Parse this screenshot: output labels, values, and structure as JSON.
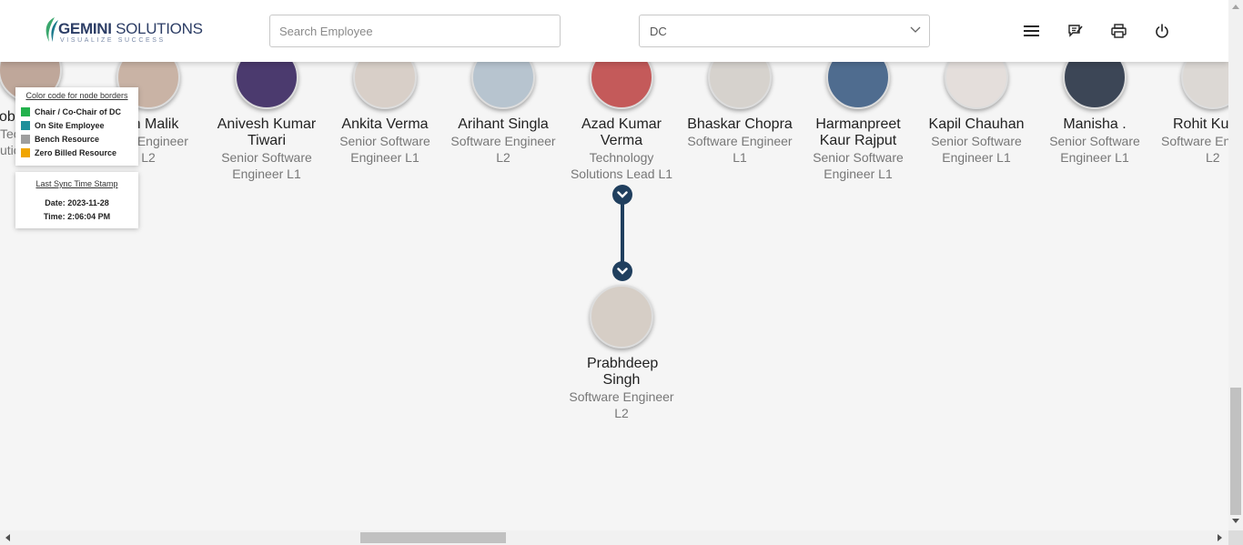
{
  "header": {
    "logo": {
      "brand_bold": "GEMINI",
      "brand_rest": " SOLUTIONS",
      "tagline": "VISUALIZE SUCCESS"
    },
    "search": {
      "placeholder": "Search Employee",
      "value": ""
    },
    "department": {
      "selected": "DC"
    },
    "actions": [
      {
        "name": "menu-icon"
      },
      {
        "name": "feedback-icon"
      },
      {
        "name": "print-icon"
      },
      {
        "name": "power-icon"
      }
    ]
  },
  "legend": {
    "title": "Color code for node borders",
    "items": [
      {
        "label": "Chair / Co-Chair of DC",
        "color": "#22b14c"
      },
      {
        "label": "On Site Employee",
        "color": "#1f8f9a"
      },
      {
        "label": "Bench Resource",
        "color": "#9e9e9e"
      },
      {
        "label": "Zero Billed Resource",
        "color": "#f0a500"
      }
    ]
  },
  "sync": {
    "title": "Last Sync Time Stamp",
    "date": "Date: 2023-11-28",
    "time": "Time: 2:06:04 PM"
  },
  "employees": [
    {
      "name": "obi",
      "designation1": "Tec",
      "designation2": "utic"
    },
    {
      "name": "h Malik",
      "designation1": "e Engineer",
      "designation2": "L2"
    },
    {
      "name": "Anivesh Kumar Tiwari",
      "designation": "Senior Software Engineer L1"
    },
    {
      "name": "Ankita Verma",
      "designation": "Senior Software Engineer L1"
    },
    {
      "name": "Arihant Singla",
      "designation": "Software Engineer L2"
    },
    {
      "name": "Azad Kumar Verma",
      "designation": "Technology Solutions Lead L1"
    },
    {
      "name": "Bhaskar Chopra",
      "designation": "Software Engineer L1"
    },
    {
      "name": "Harmanpreet Kaur Rajput",
      "designation": "Senior Software Engineer L1"
    },
    {
      "name": "Kapil Chauhan",
      "designation": "Senior Software Engineer L1"
    },
    {
      "name": "Manisha .",
      "designation": "Senior Software Engineer L1"
    },
    {
      "name": "Rohit Ku",
      "designation": "Software En",
      "designation2": "L2"
    }
  ],
  "report": {
    "name": "Prabhdeep Singh",
    "designation": "Software Engineer L2"
  }
}
